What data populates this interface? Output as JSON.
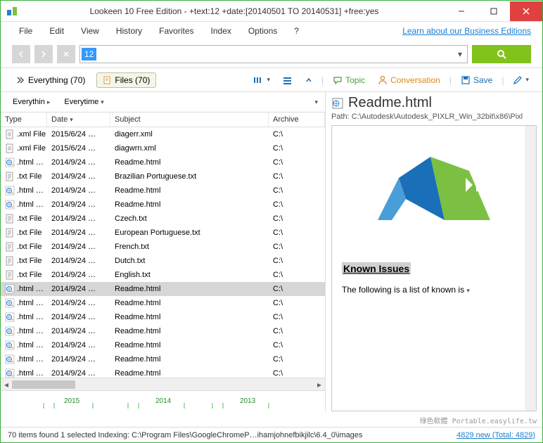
{
  "window": {
    "title": "Lookeen 10 Free Edition - +text:12 +date:[20140501 TO 20140531] +free:yes"
  },
  "menu": [
    "File",
    "Edit",
    "View",
    "History",
    "Favorites",
    "Index",
    "Options",
    "?"
  ],
  "learn_link": "Learn about our Business Editions",
  "search": {
    "value": "12"
  },
  "tabs": {
    "everything": "Everything (70)",
    "files": "Files (70)"
  },
  "actions": {
    "topic": "Topic",
    "conversation": "Conversation",
    "save": "Save"
  },
  "filters": {
    "scope": "Everythin",
    "time": "Everytime"
  },
  "columns": {
    "type": "Type",
    "date": "Date",
    "subject": "Subject",
    "archive": "Archive"
  },
  "rows": [
    {
      "icon": "xml",
      "type": ".xml File",
      "date": "2015/6/24 …",
      "subject": "diagerr.xml",
      "archive": "C:\\",
      "sel": false
    },
    {
      "icon": "xml",
      "type": ".xml File",
      "date": "2015/6/24 …",
      "subject": "diagwrn.xml",
      "archive": "C:\\",
      "sel": false
    },
    {
      "icon": "html",
      "type": ".html …",
      "date": "2014/9/24 …",
      "subject": "Readme.html",
      "archive": "C:\\",
      "sel": false
    },
    {
      "icon": "txt",
      "type": ".txt File",
      "date": "2014/9/24 …",
      "subject": "Brazilian Portuguese.txt",
      "archive": "C:\\",
      "sel": false
    },
    {
      "icon": "html",
      "type": ".html …",
      "date": "2014/9/24 …",
      "subject": "Readme.html",
      "archive": "C:\\",
      "sel": false
    },
    {
      "icon": "html",
      "type": ".html …",
      "date": "2014/9/24 …",
      "subject": "Readme.html",
      "archive": "C:\\",
      "sel": false
    },
    {
      "icon": "txt",
      "type": ".txt File",
      "date": "2014/9/24 …",
      "subject": "Czech.txt",
      "archive": "C:\\",
      "sel": false
    },
    {
      "icon": "txt",
      "type": ".txt File",
      "date": "2014/9/24 …",
      "subject": "European Portuguese.txt",
      "archive": "C:\\",
      "sel": false
    },
    {
      "icon": "txt",
      "type": ".txt File",
      "date": "2014/9/24 …",
      "subject": "French.txt",
      "archive": "C:\\",
      "sel": false
    },
    {
      "icon": "txt",
      "type": ".txt File",
      "date": "2014/9/24 …",
      "subject": "Dutch.txt",
      "archive": "C:\\",
      "sel": false
    },
    {
      "icon": "txt",
      "type": ".txt File",
      "date": "2014/9/24 …",
      "subject": "English.txt",
      "archive": "C:\\",
      "sel": false
    },
    {
      "icon": "html",
      "type": ".html …",
      "date": "2014/9/24 …",
      "subject": "Readme.html",
      "archive": "C:\\",
      "sel": true
    },
    {
      "icon": "html",
      "type": ".html …",
      "date": "2014/9/24 …",
      "subject": "Readme.html",
      "archive": "C:\\",
      "sel": false
    },
    {
      "icon": "html",
      "type": ".html …",
      "date": "2014/9/24 …",
      "subject": "Readme.html",
      "archive": "C:\\",
      "sel": false
    },
    {
      "icon": "html",
      "type": ".html …",
      "date": "2014/9/24 …",
      "subject": "Readme.html",
      "archive": "C:\\",
      "sel": false
    },
    {
      "icon": "html",
      "type": ".html …",
      "date": "2014/9/24 …",
      "subject": "Readme.html",
      "archive": "C:\\",
      "sel": false
    },
    {
      "icon": "html",
      "type": ".html …",
      "date": "2014/9/24 …",
      "subject": "Readme.html",
      "archive": "C:\\",
      "sel": false
    },
    {
      "icon": "html",
      "type": ".html …",
      "date": "2014/9/24 …",
      "subject": "Readme.html",
      "archive": "C:\\",
      "sel": false
    }
  ],
  "timeline": {
    "years": [
      "2015",
      "2014",
      "2013"
    ]
  },
  "preview": {
    "title": "Readme.html",
    "path": "Path: C:\\Autodesk\\Autodesk_PIXLR_Win_32bit\\x86\\Pixl",
    "heading": "Known Issues",
    "body": "The following is a list of known is"
  },
  "status": {
    "text": "70 items found  1 selected  Indexing: C:\\Program Files\\GoogleChromeP…ihamjohnefbikjilc\\6.4_0\\images",
    "link": "4829 new (Total: 4829)"
  },
  "watermark": "綠色軟體 Portable.easylife.tw"
}
